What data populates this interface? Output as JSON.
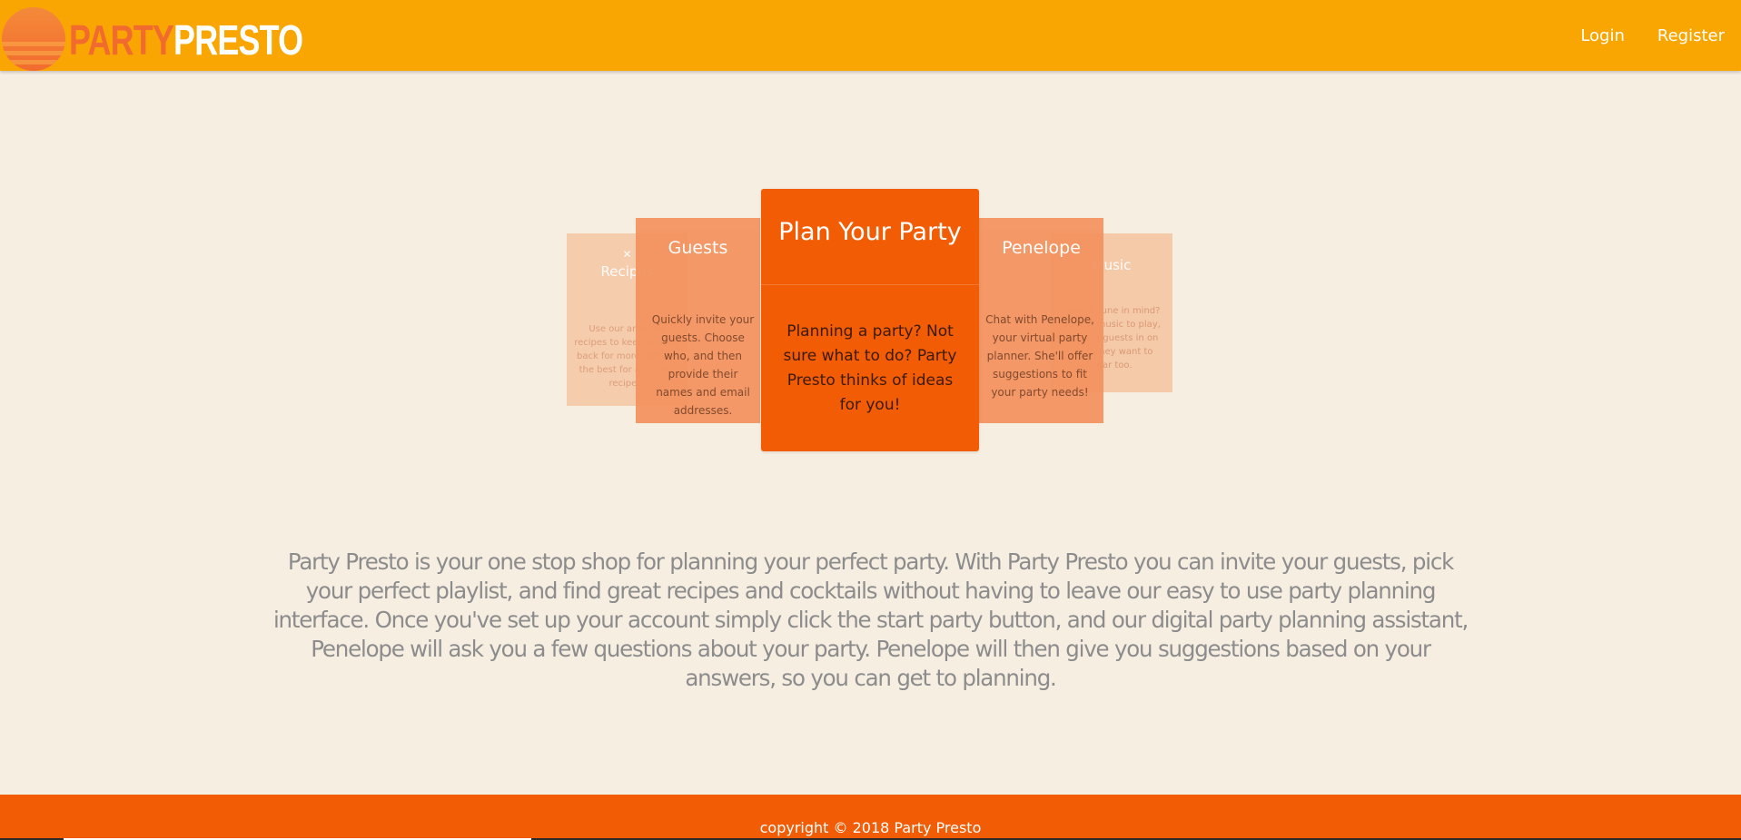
{
  "header": {
    "logo": {
      "part1": "PARTY",
      "part2": "PRESTO"
    },
    "nav": {
      "login": "Login",
      "register": "Register"
    },
    "colors": {
      "bar": "#f9a602",
      "logo_accent": "#f26b2e"
    }
  },
  "carousel": {
    "cards": [
      {
        "id": "recipes",
        "icon": "utensils-icon",
        "title": "Recipes",
        "description": "Use our amazing recipes to keep coming back for more. We are the best for all to the recipes!"
      },
      {
        "id": "guests",
        "title": "Guests",
        "description": "Quickly invite your guests. Choose who, and then provide their names and email addresses."
      },
      {
        "id": "plan",
        "title": "Plan Your Party",
        "description": "Planning a party? Not sure what to do? Party Presto thinks of ideas for you!"
      },
      {
        "id": "penelope",
        "title": "Penelope",
        "description": "Chat with Penelope, your virtual party planner. She'll offer suggestions to fit your party needs!"
      },
      {
        "id": "music",
        "title": "Music",
        "description": "Have a tune in mind? Search music to play, let your guests in on what they want to hear too."
      }
    ]
  },
  "about": {
    "text": "Party Presto is your one stop shop for planning your perfect party. With Party Presto you can invite your guests, pick your perfect playlist, and find great recipes and cocktails without having to leave our easy to use party planning interface. Once you've set up your account simply click the start party button, and our digital party planning assistant, Penelope will ask you a few questions about your party. Penelope will then give you suggestions based on your answers, so you can get to planning."
  },
  "footer": {
    "copyright": "copyright © 2018 Party Presto",
    "color": "#f25c05"
  }
}
